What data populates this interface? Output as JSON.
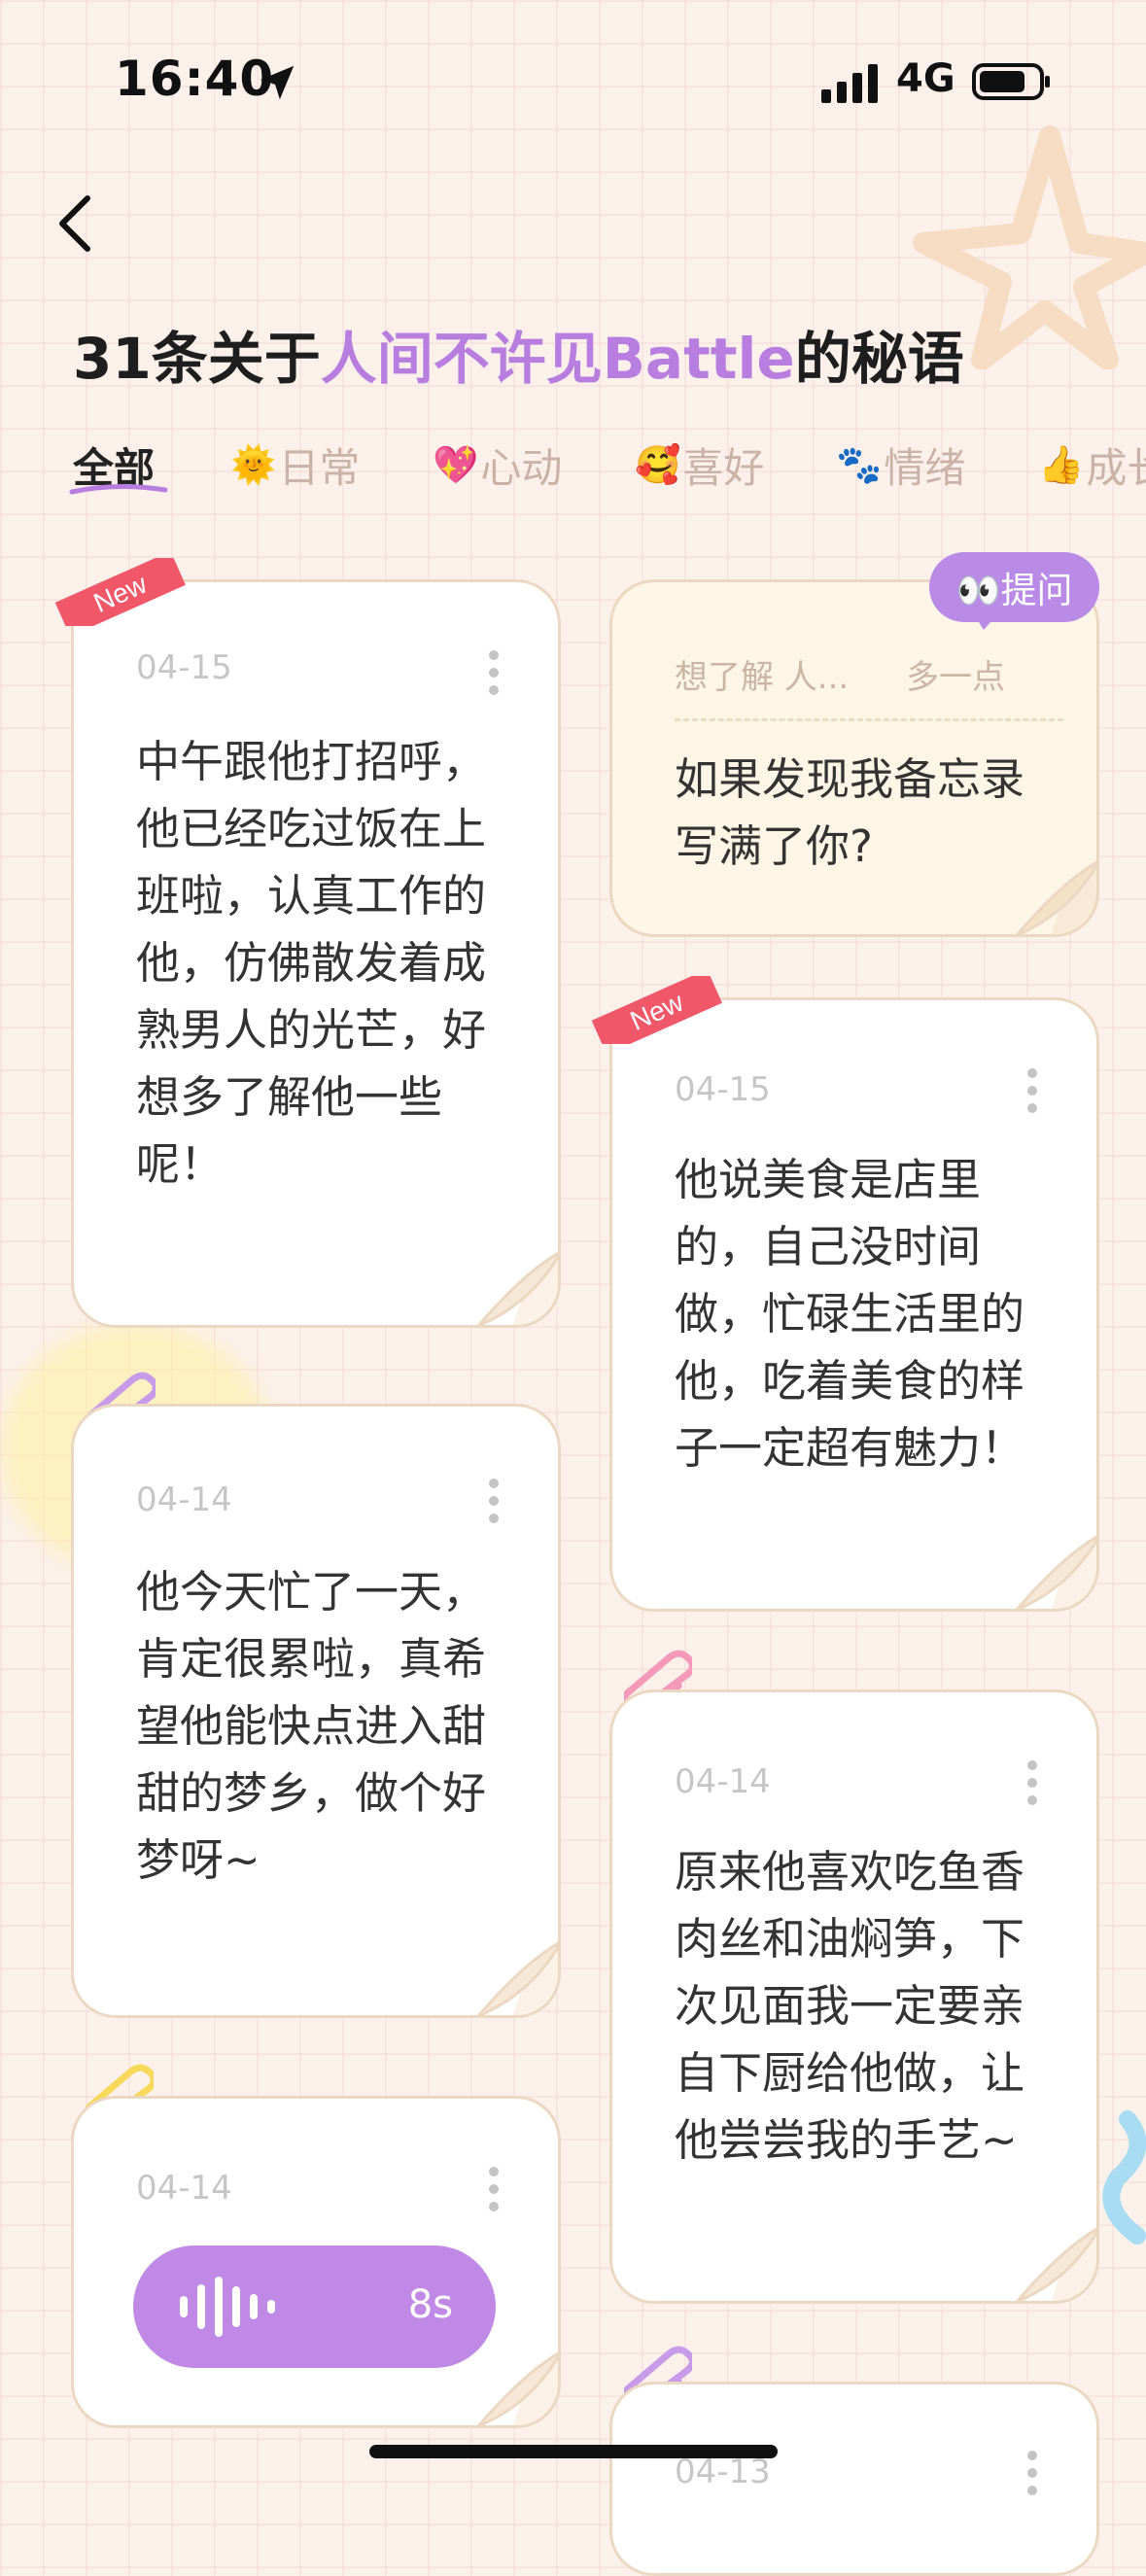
{
  "status_bar": {
    "time": "16:40",
    "network": "4G"
  },
  "header": {
    "title_prefix": "31条关于",
    "title_highlight": "人间不许见Battle",
    "title_suffix": "的秘语"
  },
  "tabs": [
    {
      "emoji": "",
      "label": "全部",
      "active": true
    },
    {
      "emoji": "🌞",
      "label": "日常",
      "active": false
    },
    {
      "emoji": "💖",
      "label": "心动",
      "active": false
    },
    {
      "emoji": "🥰",
      "label": "喜好",
      "active": false
    },
    {
      "emoji": "🐾",
      "label": "情绪",
      "active": false
    },
    {
      "emoji": "👍",
      "label": "成长",
      "active": false
    }
  ],
  "badges": {
    "new": "New"
  },
  "ask": {
    "button_label": "👀提问",
    "prompt_left": "想了解 人...",
    "prompt_right": "多一点",
    "question": "如果发现我备忘录写满了你?"
  },
  "cards": [
    {
      "date": "04-15",
      "text": "中午跟他打招呼，他已经吃过饭在上班啦，认真工作的他，仿佛散发着成熟男人的光芒，好想多了解他一些呢！",
      "new": true
    },
    {
      "date": "04-15",
      "text": "他说美食是店里的，自己没时间做，忙碌生活里的他，吃着美食的样子一定超有魅力！",
      "new": true
    },
    {
      "date": "04-14",
      "text": "他今天忙了一天，肯定很累啦，真希望他能快点进入甜甜的梦乡，做个好梦呀~",
      "new": false
    },
    {
      "date": "04-14",
      "text": "原来他喜欢吃鱼香肉丝和油焖笋，下次见面我一定要亲自下厨给他做，让他尝尝我的手艺~",
      "new": false
    },
    {
      "date": "04-14",
      "voice_duration": "8s",
      "new": false
    },
    {
      "date": "04-13",
      "new": false
    }
  ],
  "colors": {
    "accent_purple": "#b77ee0",
    "new_badge_red": "#f0586a",
    "card_border": "#ead8c2"
  }
}
